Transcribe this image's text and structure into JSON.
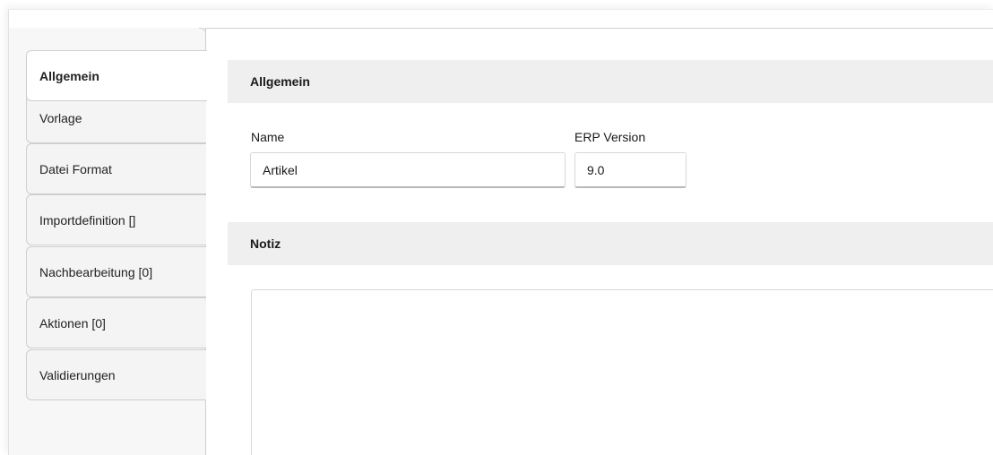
{
  "tabs": [
    {
      "label": "Allgemein",
      "active": true
    },
    {
      "label": "Vorlage",
      "active": false
    },
    {
      "label": "Datei Format",
      "active": false
    },
    {
      "label": "Importdefinition []",
      "active": false
    },
    {
      "label": "Nachbearbeitung [0]",
      "active": false
    },
    {
      "label": "Aktionen [0]",
      "active": false
    },
    {
      "label": "Validierungen",
      "active": false
    }
  ],
  "general_section": {
    "title": "Allgemein",
    "name_label": "Name",
    "name_value": "Artikel",
    "erp_label": "ERP Version",
    "erp_value": "9.0"
  },
  "note_section": {
    "title": "Notiz",
    "note_value": ""
  }
}
